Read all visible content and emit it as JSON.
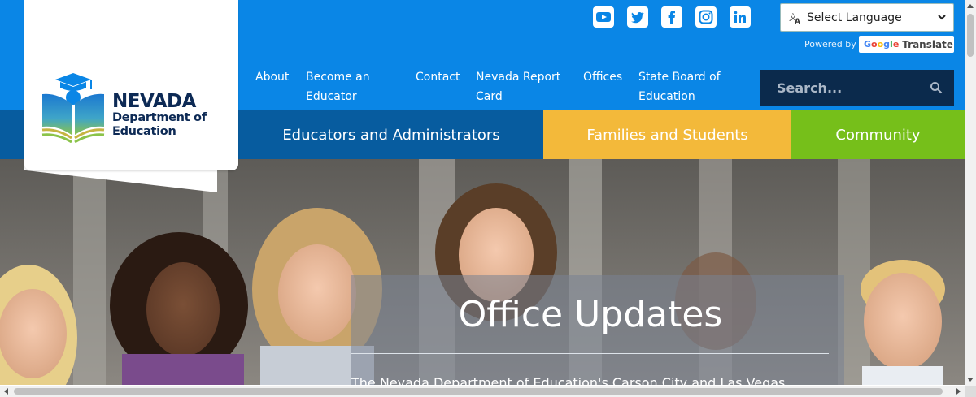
{
  "logo": {
    "title": "NEVADA",
    "sub1": "Department of",
    "sub2": "Education",
    "icon": "book-graduation-cap-logo"
  },
  "social": [
    {
      "name": "youtube-icon"
    },
    {
      "name": "twitter-icon"
    },
    {
      "name": "facebook-icon"
    },
    {
      "name": "instagram-icon"
    },
    {
      "name": "linkedin-icon"
    }
  ],
  "translate": {
    "select_label": "Select Language",
    "powered_by": "Powered by",
    "google_letters": [
      "G",
      "o",
      "o",
      "g",
      "l",
      "e"
    ],
    "translate_word": "Translate"
  },
  "topnav": {
    "about": "About",
    "become_1": "Become an",
    "become_2": "Educator",
    "contact": "Contact",
    "report_1": "Nevada Report",
    "report_2": "Card",
    "offices": "Offices",
    "board_1": "State Board of",
    "board_2": "Education"
  },
  "search": {
    "placeholder": "Search..."
  },
  "mainnav": {
    "educators": "Educators and Administrators",
    "families": "Families and Students",
    "community": "Community"
  },
  "hero": {
    "title": "Office Updates",
    "text": "The Nevada Department of Education's Carson City and Las Vegas"
  },
  "colors": {
    "top_blue": "#0a86e6",
    "nav_dark_blue": "#075c9f",
    "families_yellow": "#f3b93a",
    "community_green": "#76bf1a",
    "search_navy": "#0b2a4c",
    "logo_navy": "#0d2a55"
  }
}
